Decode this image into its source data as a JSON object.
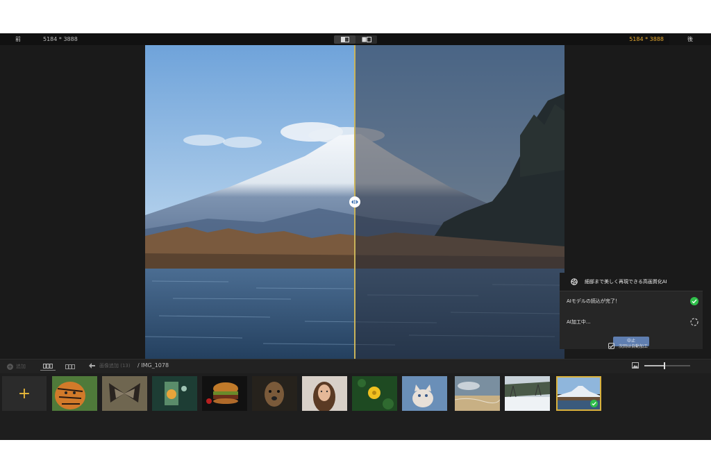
{
  "top_bar": {
    "before_label": "前",
    "after_label": "後",
    "resolution_before": "5184 * 3888",
    "resolution_after": "5184 * 3888",
    "accent_color": "#e7a92f"
  },
  "viewer": {
    "split_fraction": 0.5,
    "divider_color": "#c9b35a"
  },
  "ai_panel": {
    "title": "細部まで美しく再現できる高画質化AI",
    "steps": [
      {
        "label": "AIモデルの読込が完了！",
        "status": "done"
      },
      {
        "label": "AI加工中...",
        "status": "processing"
      }
    ],
    "stop_button": "中止",
    "auto_next_label": "次回は自動加工",
    "auto_next_checked": true,
    "done_color": "#2fbf4a"
  },
  "bottom_bar": {
    "add_label": "追加",
    "back_label": "画像追加 (13)",
    "path": "/ IMG_1078",
    "zoom_level": 0.44
  },
  "thumbnails": [
    {
      "name": "tiger"
    },
    {
      "name": "butterfly"
    },
    {
      "name": "lantern"
    },
    {
      "name": "burger"
    },
    {
      "name": "dog"
    },
    {
      "name": "woman"
    },
    {
      "name": "yellow-flower"
    },
    {
      "name": "cat"
    },
    {
      "name": "beach"
    },
    {
      "name": "snow"
    },
    {
      "name": "fuji",
      "selected": true
    }
  ]
}
